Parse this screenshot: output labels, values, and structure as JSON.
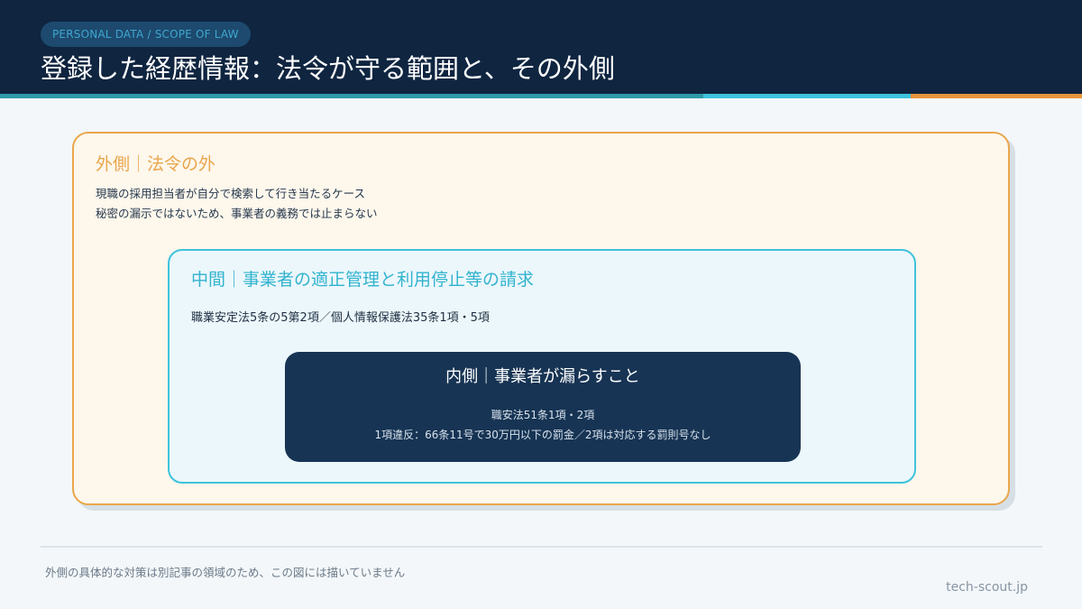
{
  "header": {
    "tag": "PERSONAL DATA / SCOPE OF LAW",
    "title": "登録した経歴情報：法令が守る範囲と、その外側"
  },
  "diagram": {
    "outer": {
      "title": "外側｜法令の外",
      "lines": [
        "現職の採用担当者が自分で検索して行き当たるケース",
        "秘密の漏示ではないため、事業者の義務では止まらない"
      ]
    },
    "middle": {
      "title": "中間｜事業者の適正管理と利用停止等の請求",
      "line": "職業安定法5条の5第2項／個人情報保護法35条1項・5項"
    },
    "inner": {
      "title": "内側｜事業者が漏らすこと",
      "lines": [
        "職安法51条1項・2項",
        "1項違反：66条11号で30万円以下の罰金／2項は対応する罰則号なし"
      ]
    }
  },
  "footer": {
    "note": "外側の具体的な対策は別記事の領域のため、この図には描いていません",
    "brand": "tech-scout.jp"
  },
  "colors": {
    "header_bg": "#0f2540",
    "outer_accent": "#e9a64b",
    "middle_accent": "#3ec3dc",
    "inner_bg": "#173454"
  }
}
